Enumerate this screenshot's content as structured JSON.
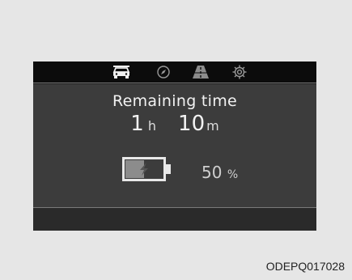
{
  "tabs": [
    {
      "name": "car-icon",
      "active": true
    },
    {
      "name": "compass-icon",
      "active": false
    },
    {
      "name": "road-icon",
      "active": false
    },
    {
      "name": "settings-icon",
      "active": false
    }
  ],
  "main": {
    "title": "Remaining time",
    "hours_value": "1",
    "hours_unit": "h",
    "minutes_value": "10",
    "minutes_unit": "m",
    "battery_level_percent": 50,
    "soc_value": "50",
    "soc_unit": "%"
  },
  "image_code": "ODEPQ017028",
  "colors": {
    "background": "#e6e6e6",
    "screen": "#1a1a1a",
    "content": "#3c3c3c",
    "text": "#f2f2f2"
  }
}
